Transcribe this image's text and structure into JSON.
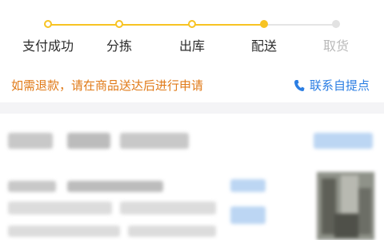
{
  "progress": {
    "steps": [
      {
        "label": "支付成功",
        "state": "done"
      },
      {
        "label": "分拣",
        "state": "done"
      },
      {
        "label": "出库",
        "state": "done"
      },
      {
        "label": "配送",
        "state": "current"
      },
      {
        "label": "取货",
        "state": "future"
      }
    ]
  },
  "notice": {
    "text": "如需退款，请在商品送达后进行申请"
  },
  "contact": {
    "label": "联系自提点",
    "icon": "phone-icon"
  },
  "colors": {
    "accent": "#f7c323",
    "notice": "#e07a18",
    "link": "#2b7ee3"
  }
}
